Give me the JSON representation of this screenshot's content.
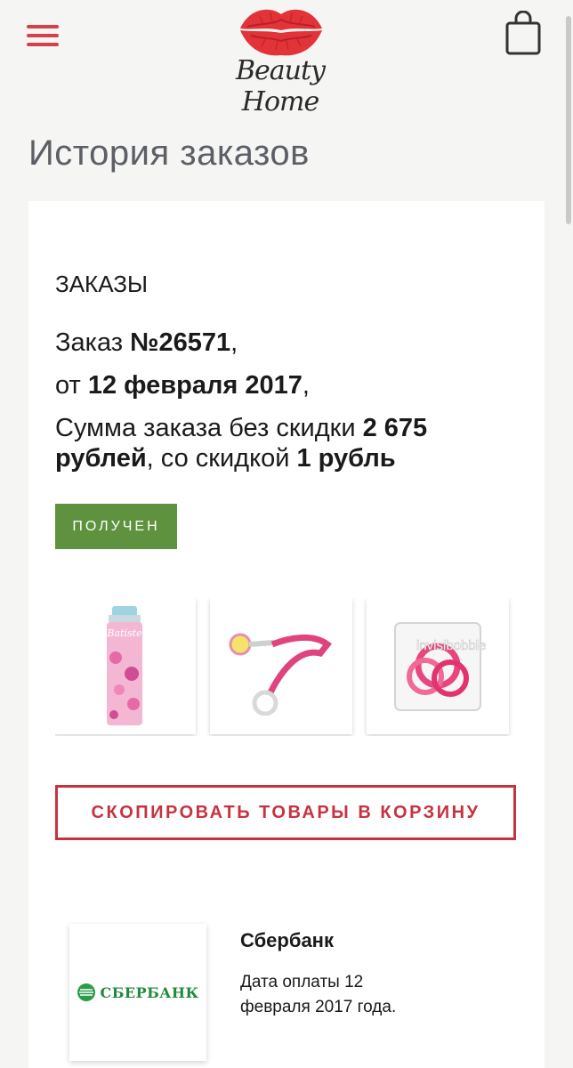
{
  "header": {
    "logo_text": "Beauty Home",
    "menu_icon": "hamburger-menu-icon",
    "cart_icon": "shopping-bag-icon",
    "accent_color": "#d6404a"
  },
  "page": {
    "title": "История заказов"
  },
  "orders": {
    "section_title": "ЗАКАЗЫ",
    "order_label": "Заказ ",
    "order_number": "№26571",
    "order_number_suffix": ",",
    "date_prefix": "от ",
    "date": "12 февраля 2017",
    "date_suffix": ",",
    "sum_prefix": "Сумма заказа без скидки ",
    "sum_full": "2 675 рублей",
    "sum_middle": ", со скидкой ",
    "sum_discounted": "1 рубль",
    "status": "ПОЛУЧЕН",
    "status_color": "#5f923e",
    "products": [
      {
        "name": "Batiste",
        "icon": "dry-shampoo-bottle-icon"
      },
      {
        "name": "",
        "icon": "pacifier-holder-icon"
      },
      {
        "name": "invisibobble",
        "icon": "hair-ring-box-icon"
      }
    ],
    "copy_button": "СКОПИРОВАТЬ ТОВАРЫ В КОРЗИНУ",
    "copy_button_color": "#c8323f"
  },
  "payment": {
    "logo_text": "СБЕРБАНК",
    "bank_name": "Сбербанк",
    "date_text": "Дата оплаты 12 февраля 2017 года."
  }
}
